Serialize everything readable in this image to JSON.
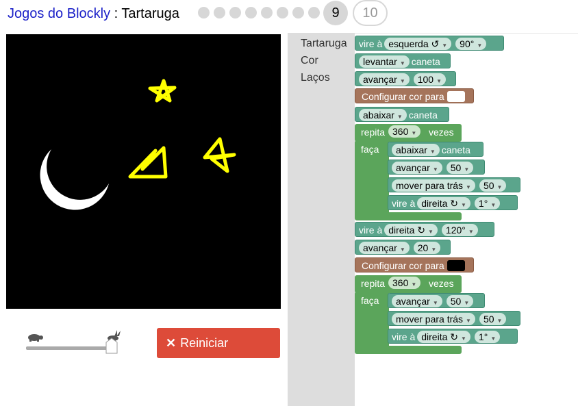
{
  "header": {
    "app_link": "Jogos do Blockly",
    "separator": " : ",
    "game_name": "Tartaruga",
    "level_current": "9",
    "level_next": "10"
  },
  "controls": {
    "reset_label": "Reiniciar"
  },
  "toolbox": {
    "categories": [
      "Tartaruga",
      "Cor",
      "Laços"
    ]
  },
  "blocks": {
    "turn_label": "vire à",
    "turn_left": "esquerda ↺",
    "turn_right": "direita ↻",
    "deg_90": "90°",
    "deg_120": "120°",
    "deg_1": "1°",
    "pen_up": "levantar",
    "pen_down": "abaixar",
    "pen_word": "caneta",
    "forward": "avançar",
    "backward": "mover para trás",
    "n100": "100",
    "n50": "50",
    "n20": "20",
    "n360": "360",
    "set_colour": "Configurar cor para",
    "repeat": "repita",
    "times": "vezes",
    "do": "faça"
  },
  "colors": {
    "turtle_block": "#5ba58c",
    "loop_block": "#5ba55b",
    "colour_block": "#a5745b",
    "reset_button": "#dd4b39",
    "swatch_white": "#ffffff",
    "swatch_black": "#000000",
    "star_color": "#ffff00"
  }
}
